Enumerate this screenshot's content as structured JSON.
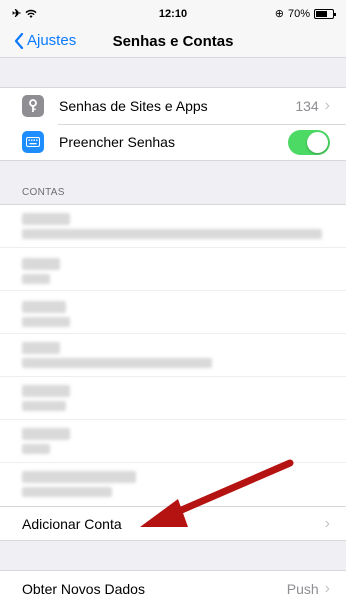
{
  "status_bar": {
    "time": "12:10",
    "battery": "70%"
  },
  "nav": {
    "back_label": "Ajustes",
    "title": "Senhas e Contas"
  },
  "passwords_group": {
    "items": [
      {
        "label": "Senhas de Sites e Apps",
        "value": "134",
        "icon": "key-icon",
        "icon_color": "#8e8e93"
      },
      {
        "label": "Preencher Senhas",
        "toggle": true,
        "icon": "keyboard-icon",
        "icon_color": "#1e8dff"
      }
    ]
  },
  "accounts_section": {
    "header": "CONTAS"
  },
  "add_account": {
    "label": "Adicionar Conta"
  },
  "fetch": {
    "label": "Obter Novos Dados",
    "value": "Push"
  },
  "colors": {
    "accent": "#0a7aff",
    "toggle_on": "#4cd964",
    "annotation_arrow": "#b51212"
  }
}
